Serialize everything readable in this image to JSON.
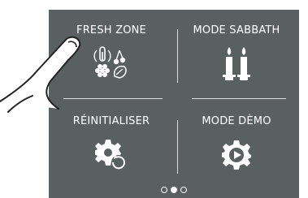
{
  "tiles": [
    {
      "label": "FRESH ZONE",
      "icon": "fresh-zone-icon"
    },
    {
      "label": "MODE SABBATH",
      "icon": "candles-icon"
    },
    {
      "label": "RÉINITIALISER",
      "icon": "reset-gear-icon"
    },
    {
      "label": "MODE DÈMO",
      "icon": "demo-gear-play-icon"
    }
  ],
  "pager": {
    "count": 3,
    "active_index": 1
  },
  "colors": {
    "panel": "#5a605f",
    "text": "#ffffff",
    "divider": "#d9dcdb"
  }
}
